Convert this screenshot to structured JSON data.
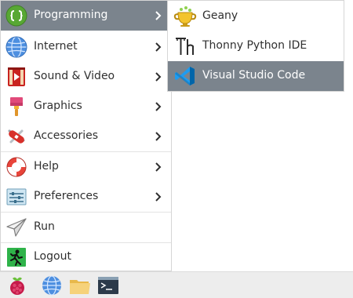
{
  "main_menu": {
    "items": [
      {
        "label": "Programming",
        "icon": "programming-icon",
        "submenu": true,
        "active": true
      },
      {
        "label": "Internet",
        "icon": "globe-icon",
        "submenu": true
      },
      {
        "label": "Sound & Video",
        "icon": "sound-video-icon",
        "submenu": true
      },
      {
        "label": "Graphics",
        "icon": "paintbrush-icon",
        "submenu": true
      },
      {
        "label": "Accessories",
        "icon": "swiss-knife-icon",
        "submenu": true
      },
      {
        "label": "Help",
        "icon": "lifebuoy-icon",
        "submenu": true
      },
      {
        "label": "Preferences",
        "icon": "preferences-icon",
        "submenu": true
      },
      {
        "label": "Run",
        "icon": "paper-plane-icon",
        "submenu": false
      },
      {
        "label": "Logout",
        "icon": "logout-icon",
        "submenu": false
      }
    ]
  },
  "sub_menu": {
    "items": [
      {
        "label": "Geany",
        "icon": "geany-icon"
      },
      {
        "label": "Thonny Python IDE",
        "icon": "thonny-icon"
      },
      {
        "label": "Visual Studio Code",
        "icon": "vscode-icon",
        "active": true
      }
    ]
  },
  "taskbar": {
    "buttons": [
      {
        "icon": "raspberry-menu-icon"
      },
      {
        "icon": "web-browser-icon"
      },
      {
        "icon": "file-manager-icon"
      },
      {
        "icon": "terminal-icon"
      }
    ]
  },
  "colors": {
    "highlight": "#7b848d",
    "menu_text": "#303030",
    "highlight_text": "#ffffff",
    "taskbar_bg": "#ededed"
  }
}
